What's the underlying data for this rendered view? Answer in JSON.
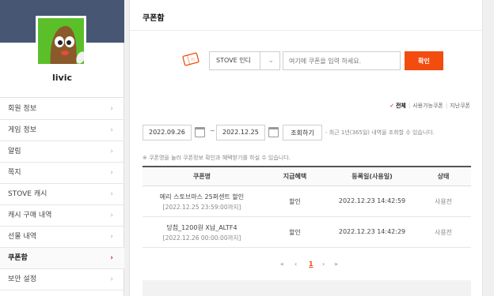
{
  "profile": {
    "username": "livic"
  },
  "sidebar": {
    "items": [
      {
        "label": "회원 정보"
      },
      {
        "label": "게임 정보"
      },
      {
        "label": "알림"
      },
      {
        "label": "쪽지"
      },
      {
        "label": "STOVE 캐시"
      },
      {
        "label": "캐시 구매 내역"
      },
      {
        "label": "선물 내역"
      },
      {
        "label": "쿠폰함"
      },
      {
        "label": "보안 설정"
      }
    ],
    "active_index": 7
  },
  "main": {
    "title": "쿠폰함",
    "platform_select": "STOVE 인디",
    "coupon_placeholder": "여기에 쿠폰을 입력 하세요.",
    "confirm_label": "확인",
    "filters": {
      "all": "전체",
      "available": "사용가능쿠폰",
      "past": "지난쿠폰"
    },
    "date_from": "2022.09.26",
    "date_to": "2022.12.25",
    "lookup_label": "조회하기",
    "date_note": "- 최근 1년(365일) 내역을 조회할 수 있습니다.",
    "hint": "※ 쿠폰명을 눌러 쿠폰정보 확인과 혜택받기를 하실 수 있습니다.",
    "table": {
      "headers": [
        "쿠폰명",
        "지급혜택",
        "등록일(사용일)",
        "상태"
      ],
      "rows": [
        {
          "name": "메리 스토브마스 25퍼센트 할인",
          "expiry": "[2022.12.25 23:59:00까지]",
          "benefit": "할인",
          "date": "2022.12.23 14:42:59",
          "status": "사용전"
        },
        {
          "name": "당첨_1200원 X납_ALTF4",
          "expiry": "[2022.12.26 00:00:00까지]",
          "benefit": "할인",
          "date": "2022.12.23 14:42:29",
          "status": "사용전"
        }
      ]
    },
    "pager": {
      "first": "«",
      "prev": "‹",
      "current": "1",
      "next": "›",
      "last": "»"
    }
  },
  "colors": {
    "accent": "#f24c0f",
    "active_chevron": "#e60012",
    "banner": "#475672",
    "avatar_bg": "#5bbf2a"
  },
  "icons": [
    "coupon-ticket-icon",
    "calendar-icon",
    "chevron-right-icon",
    "chevron-down-icon",
    "check-icon"
  ]
}
